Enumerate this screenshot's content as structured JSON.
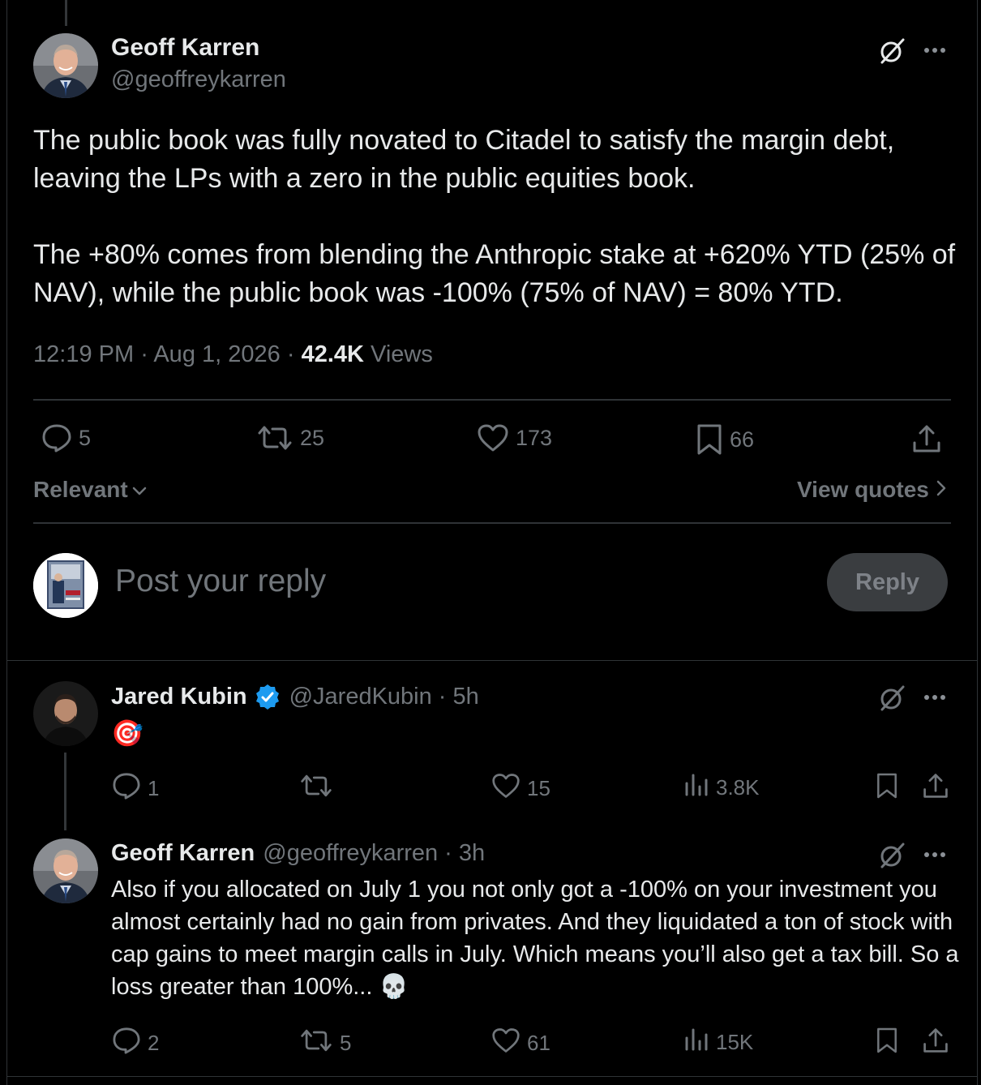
{
  "main_tweet": {
    "author_name": "Geoff Karren",
    "author_handle": "@geoffreykarren",
    "paragraph_1": "The public book was fully novated to Citadel to satisfy the margin debt, leaving the LPs with a zero in the public equities book.",
    "paragraph_2": "The +80% comes from blending the Anthropic stake at +620% YTD (25% of NAV), while the public book was -100% (75% of NAV) = 80% YTD.",
    "time": "12:19 PM",
    "date": "Aug 1, 2026",
    "separator": "·",
    "views_count": "42.4K",
    "views_label": "Views",
    "replies": "5",
    "reposts": "25",
    "likes": "173",
    "bookmarks": "66"
  },
  "sort": {
    "label": "Relevant",
    "view_quotes": "View quotes"
  },
  "composer": {
    "placeholder": "Post your reply",
    "button_label": "Reply"
  },
  "replies": [
    {
      "author_name": "Jared Kubin",
      "verified": true,
      "author_handle": "@JaredKubin",
      "time": "· 5h",
      "text": "🎯",
      "replies": "1",
      "reposts": "",
      "likes": "15",
      "views": "3.8K"
    },
    {
      "author_name": "Geoff Karren",
      "author_handle": "@geoffreykarren",
      "time": "· 3h",
      "text": "Also if you allocated on July 1 you not only got a -100% on your investment you almost certainly had no gain from privates. And they liquidated a ton of stock with cap gains to meet margin calls in July. Which means you’ll also get a tax bill. So a loss greater than 100%... 💀",
      "replies": "2",
      "reposts": "5",
      "likes": "61",
      "views": "15K"
    }
  ],
  "colors": {
    "background": "#000000",
    "text": "#e7e9ea",
    "secondary": "#71767b",
    "divider": "#2f3336",
    "verified": "#1d9bf0"
  }
}
